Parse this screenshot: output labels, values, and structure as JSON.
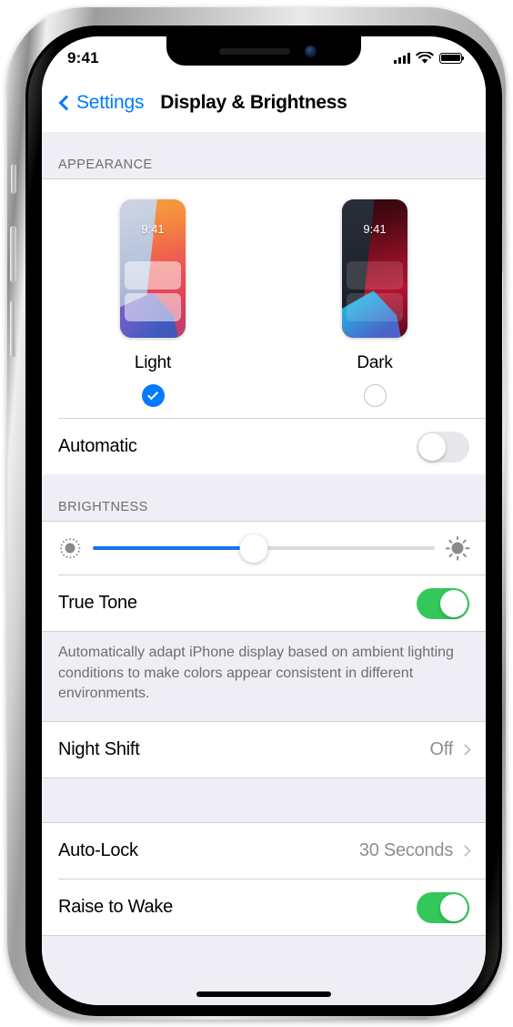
{
  "device": {
    "name": "iphone-x-frame"
  },
  "status_bar": {
    "time": "9:41",
    "signal_icon": "cellular-signal-icon",
    "wifi_icon": "wifi-icon",
    "battery_icon": "battery-full-icon"
  },
  "nav_bar": {
    "back_label": "Settings",
    "back_icon": "chevron-left-icon",
    "title": "Display & Brightness"
  },
  "appearance": {
    "header": "APPEARANCE",
    "options": [
      {
        "label": "Light",
        "preview_time": "9:41",
        "selected": true
      },
      {
        "label": "Dark",
        "preview_time": "9:41",
        "selected": false
      }
    ],
    "automatic": {
      "label": "Automatic",
      "toggle_state": "off"
    }
  },
  "brightness": {
    "header": "BRIGHTNESS",
    "slider": {
      "value_percent": 47,
      "min_icon": "sun-small-icon",
      "max_icon": "sun-large-icon"
    },
    "true_tone": {
      "label": "True Tone",
      "toggle_state": "on"
    },
    "footer": "Automatically adapt iPhone display based on ambient lighting conditions to make colors appear consistent in different environments."
  },
  "night_shift": {
    "label": "Night Shift",
    "value": "Off",
    "chevron": "chevron-right-icon"
  },
  "lock_section": {
    "auto_lock": {
      "label": "Auto-Lock",
      "value": "30 Seconds",
      "chevron": "chevron-right-icon"
    },
    "raise_to_wake": {
      "label": "Raise to Wake",
      "toggle_state": "on"
    }
  },
  "colors": {
    "accent_blue": "#007aff",
    "toggle_green": "#34c759",
    "slider_blue": "#1573ec",
    "group_bg": "#eeeef4",
    "secondary_text": "#8e8e93"
  }
}
